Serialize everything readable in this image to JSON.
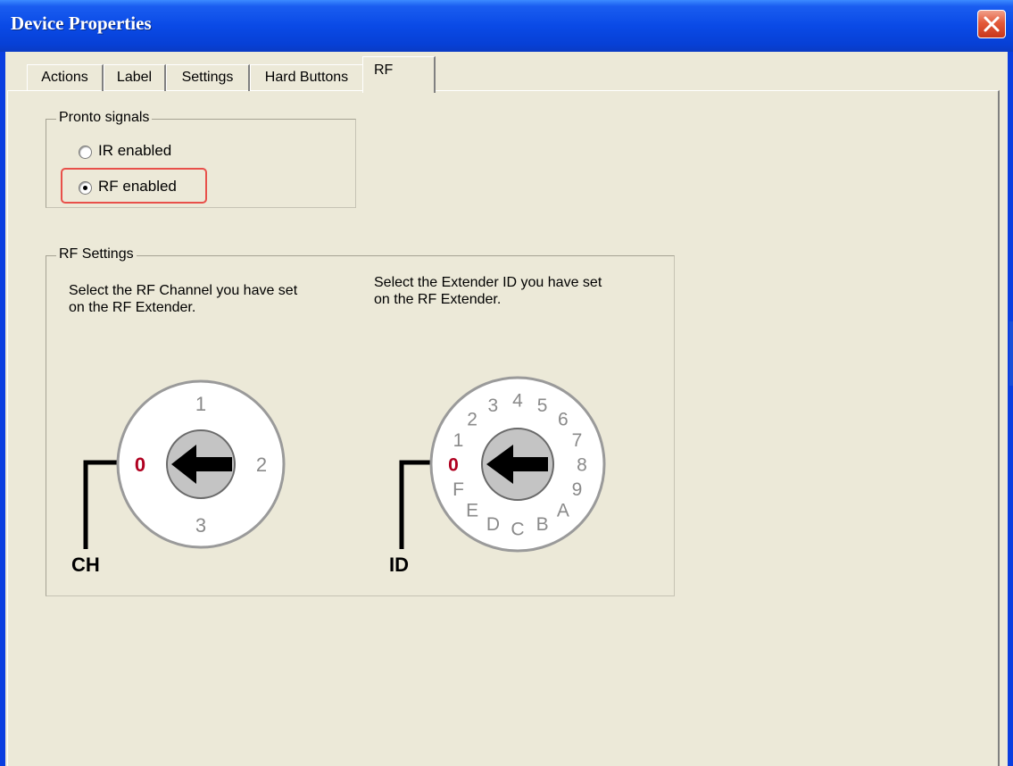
{
  "window": {
    "title": "Device Properties",
    "close_icon": "close-x-icon"
  },
  "tabs": [
    {
      "label": "Actions",
      "active": false
    },
    {
      "label": "Label",
      "active": false
    },
    {
      "label": "Settings",
      "active": false
    },
    {
      "label": "Hard Buttons",
      "active": false
    },
    {
      "label": "RF",
      "active": true
    }
  ],
  "pronto_signals": {
    "legend": "Pronto signals",
    "options": [
      {
        "label": "IR enabled",
        "selected": false
      },
      {
        "label": "RF enabled",
        "selected": true
      }
    ]
  },
  "rf_settings": {
    "legend": "RF Settings",
    "channel_instruction_line1": "Select the RF Channel you have set",
    "channel_instruction_line2": "on the RF Extender.",
    "id_instruction_line1": "Select the Extender ID you have set",
    "id_instruction_line2": "on the RF Extender.",
    "channel_dial": {
      "name": "CH",
      "positions": [
        "0",
        "1",
        "2",
        "3"
      ],
      "selected": "0"
    },
    "id_dial": {
      "name": "ID",
      "positions": [
        "0",
        "1",
        "2",
        "3",
        "4",
        "5",
        "6",
        "7",
        "8",
        "9",
        "A",
        "B",
        "C",
        "D",
        "E",
        "F"
      ],
      "selected": "0"
    }
  },
  "colors": {
    "title_bar": "#0a4ae6",
    "dialog_face": "#ece9d8",
    "highlight_border": "#e8504a",
    "selected_position": "#b00020",
    "dial_digits": "#8a8a8a"
  }
}
